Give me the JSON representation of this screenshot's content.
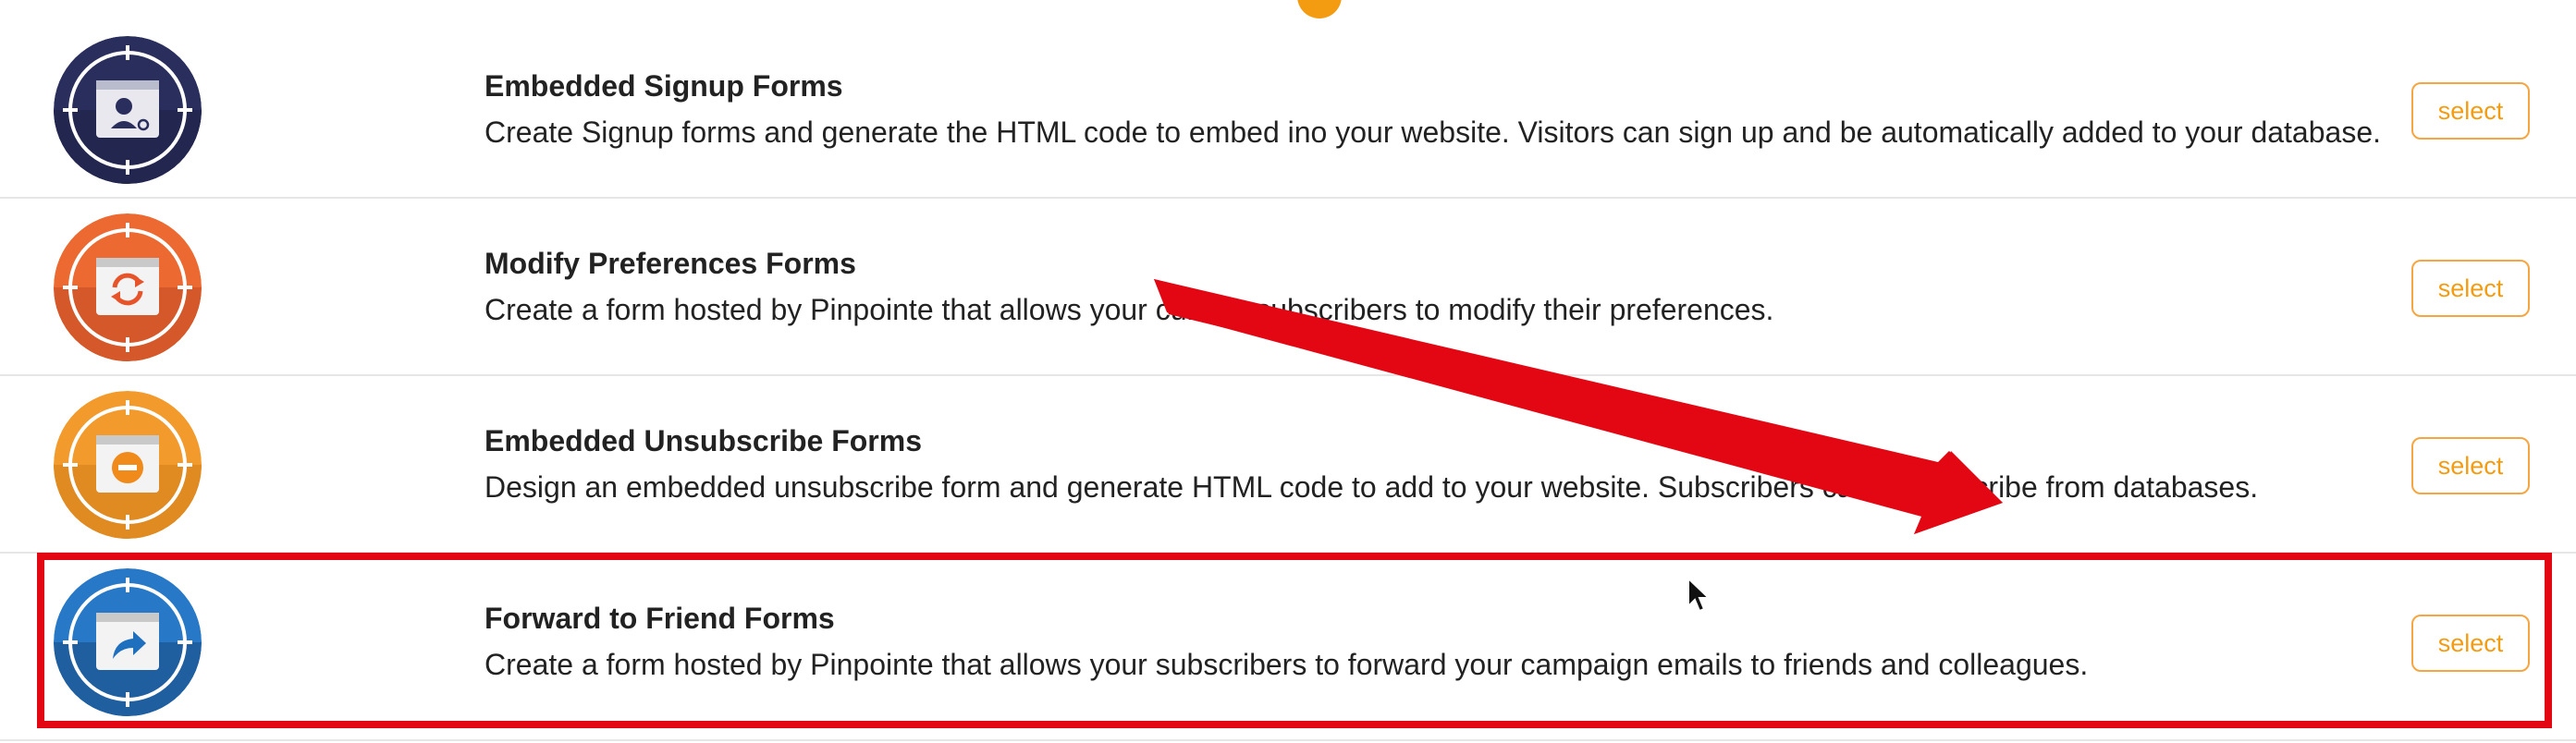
{
  "forms": [
    {
      "title": "Embedded Signup Forms",
      "description": "Create Signup forms and generate the HTML code to embed ino your website. Visitors can sign up and be automatically added to your database.",
      "select_label": "select",
      "icon": "user-add-icon",
      "colors": {
        "circle": "#2a2e5c",
        "inner": "#353a6e",
        "ring": "#ffffff"
      }
    },
    {
      "title": "Modify Preferences Forms",
      "description": "Create a form hosted by Pinpointe that allows your current subscribers to modify their preferences.",
      "select_label": "select",
      "icon": "refresh-icon",
      "colors": {
        "circle": "#d4582a",
        "inner": "#ec6a32",
        "ring": "#ffffff"
      }
    },
    {
      "title": "Embedded Unsubscribe Forms",
      "description": "Design an embedded unsubscribe form and generate HTML code to add to your website. Subscribers can unsubscribe from databases.",
      "select_label": "select",
      "icon": "minus-circle-icon",
      "colors": {
        "circle": "#e08a22",
        "inner": "#f29b2c",
        "ring": "#ffffff"
      }
    },
    {
      "title": "Forward to Friend Forms",
      "description": "Create a form hosted by Pinpointe that allows your subscribers to forward your campaign emails to friends and colleagues.",
      "select_label": "select",
      "icon": "share-forward-icon",
      "colors": {
        "circle": "#1f5fa0",
        "inner": "#2878c8",
        "ring": "#ffffff"
      }
    }
  ],
  "annotation": {
    "highlighted_item": "Forward to Friend Forms",
    "color": "#e30613"
  },
  "accent_color": "#f39c12",
  "info_icon": "info-icon"
}
